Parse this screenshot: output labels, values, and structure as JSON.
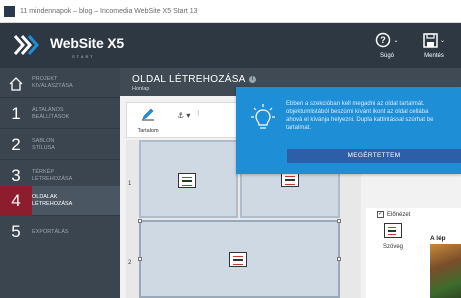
{
  "window": {
    "title": "11 mindennapok – blog – Incomedia WebSite X5 Start 13"
  },
  "brand": {
    "name": "WebSite X5",
    "sub": "START"
  },
  "toolbar_top": {
    "help_label": "Súgó",
    "save_label": "Mentés",
    "help_icon": "question-circle-icon",
    "save_icon": "floppy-icon"
  },
  "steps": [
    {
      "num": "",
      "label": "PROJEKT\nKIVÁLASZTÁSA",
      "icon": "home-icon"
    },
    {
      "num": "1",
      "label": "ÁLTALÁNOS\nBEÁLLÍTÁSOK"
    },
    {
      "num": "2",
      "label": "SABLON\nSTÍLUSA"
    },
    {
      "num": "3",
      "label": "TÉRKÉP\nLÉTREHOZÁSA"
    },
    {
      "num": "4",
      "label": "OLDALAK\nLÉTREHOZÁSA"
    },
    {
      "num": "5",
      "label": "EXPORTÁLÁS"
    }
  ],
  "page": {
    "title": "OLDAL LÉTREHOZÁSA",
    "subtitle": "Honlap"
  },
  "editor": {
    "content_label": "Tartalom",
    "anchor_label": "⚓ ▾",
    "rows": [
      "1",
      "2"
    ]
  },
  "objects": {
    "preview_label": "Előnézet",
    "text_label": "Szöveg",
    "image_caption": "A lép"
  },
  "tip": {
    "text": "Ebben a szekcióban kell megadni az oldal tartalmát.\nobjektumlistából beszúrni kívánt ikont az oldal cellába\nahová el kívánja helyezni. Dupla kattintással szúrhat be\ntartalmat.",
    "button_label": "MEGÉRTETTEM"
  },
  "colors": {
    "topbar": "#2e3843",
    "sidebar": "#3a4550",
    "active_step": "#8b1d2c",
    "tip_bg": "#1e8fd6",
    "tip_button": "#2d5fa8"
  }
}
